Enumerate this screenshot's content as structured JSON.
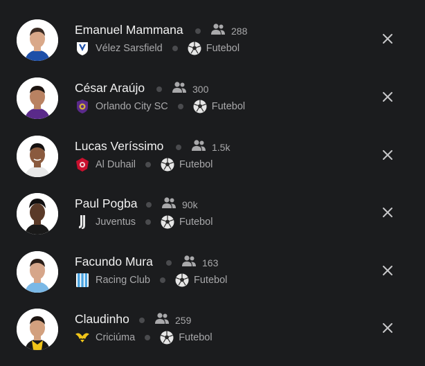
{
  "players": [
    {
      "name": "Emanuel Mammana",
      "followers": "288",
      "team": "Vélez Sarsfield",
      "team_logo": "velez-sarsfield-logo",
      "sport": "Futebol",
      "sport_icon": "soccer-ball-icon",
      "skin": "#d9a889",
      "hair": "#3a2a22",
      "shirt": "#1e4fa8"
    },
    {
      "name": "César Araújo",
      "followers": "300",
      "team": "Orlando City SC",
      "team_logo": "orlando-city-logo",
      "sport": "Futebol",
      "sport_icon": "soccer-ball-icon",
      "skin": "#b98262",
      "hair": "#1c1410",
      "shirt": "#5a2a8a"
    },
    {
      "name": "Lucas Veríssimo",
      "followers": "1.5k",
      "team": "Al Duhail",
      "team_logo": "al-duhail-logo",
      "sport": "Futebol",
      "sport_icon": "soccer-ball-icon",
      "skin": "#8a5a3e",
      "hair": "#141010",
      "shirt": "#c8102e"
    },
    {
      "name": "Paul Pogba",
      "followers": "90k",
      "team": "Juventus",
      "team_logo": "juventus-logo",
      "sport": "Futebol",
      "sport_icon": "soccer-ball-icon",
      "skin": "#5a3a28",
      "hair": "#121010",
      "shirt": "#1a1a1a"
    },
    {
      "name": "Facundo Mura",
      "followers": "163",
      "team": "Racing Club",
      "team_logo": "racing-club-logo",
      "sport": "Futebol",
      "sport_icon": "soccer-ball-icon",
      "skin": "#d6a68a",
      "hair": "#2a1e18",
      "shirt": "#7ab8e6"
    },
    {
      "name": "Claudinho",
      "followers": "259",
      "team": "Criciúma",
      "team_logo": "criciuma-logo",
      "sport": "Futebol",
      "sport_icon": "soccer-ball-icon",
      "skin": "#d2a07e",
      "hair": "#1e1612",
      "shirt": "#f0c419"
    }
  ],
  "colors": {
    "background": "#1b1c1e",
    "name_text": "#f1f1f1",
    "secondary_text": "#a9a9ab",
    "separator_dot": "#4a4b4e",
    "close_icon": "#c8c8ca"
  }
}
